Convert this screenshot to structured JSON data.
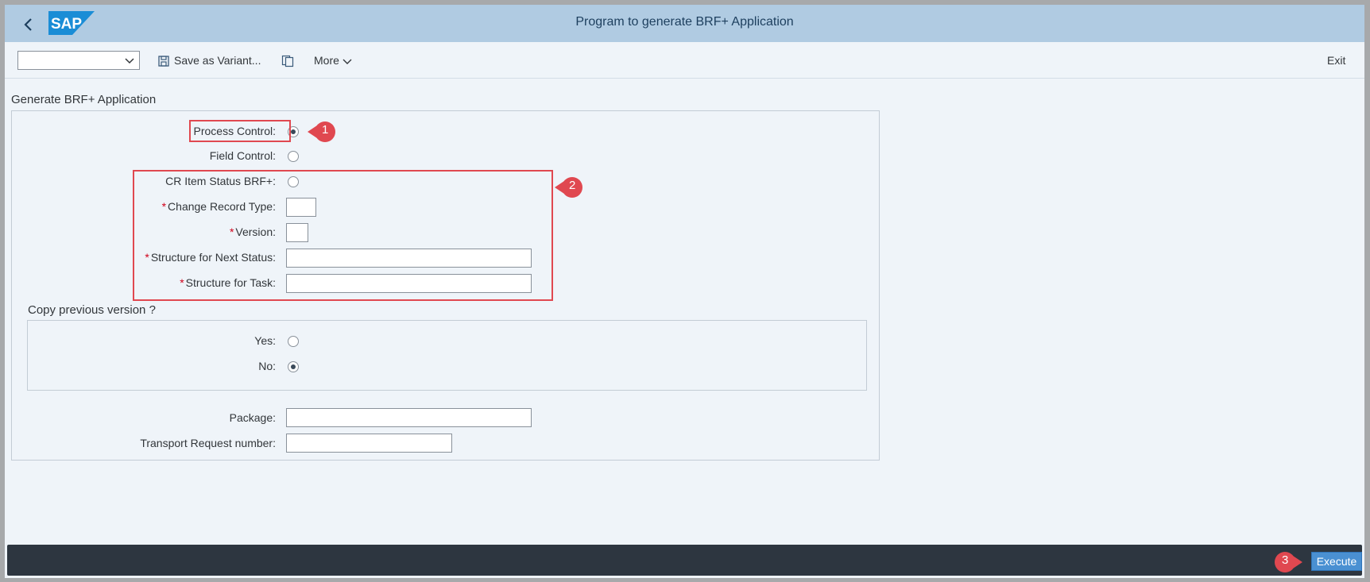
{
  "shell": {
    "title": "Program to generate BRF+ Application",
    "logo_text": "SAP"
  },
  "toolbar": {
    "variant_value": "",
    "save_variant": "Save as Variant...",
    "more": "More",
    "exit": "Exit"
  },
  "form": {
    "section_title": "Generate BRF+ Application",
    "process_control": {
      "label": "Process Control:",
      "selected": true
    },
    "field_control": {
      "label": "Field Control:",
      "selected": false
    },
    "cr_item_status": {
      "label": "CR Item Status BRF+:",
      "selected": false
    },
    "change_record_type": {
      "label": "Change Record Type:",
      "value": "",
      "required": true
    },
    "version": {
      "label": "Version:",
      "value": "",
      "required": true
    },
    "structure_next_status": {
      "label": "Structure for Next Status:",
      "value": "",
      "required": true
    },
    "structure_task": {
      "label": "Structure for Task:",
      "value": "",
      "required": true
    },
    "copy_prev": {
      "title": "Copy previous version ?",
      "yes": "Yes:",
      "no": "No:",
      "selected": "no"
    },
    "package": {
      "label": "Package:",
      "value": ""
    },
    "transport": {
      "label": "Transport Request number:",
      "value": ""
    }
  },
  "annotations": {
    "m1": "1",
    "m2": "2",
    "m3": "3"
  },
  "footer": {
    "execute": "Execute"
  },
  "colors": {
    "shell_bg": "#b0cbe2",
    "page_bg": "#eff4f9",
    "footer_bg": "#2d3640",
    "accent": "#4a90d2",
    "annotation": "#e04850"
  }
}
